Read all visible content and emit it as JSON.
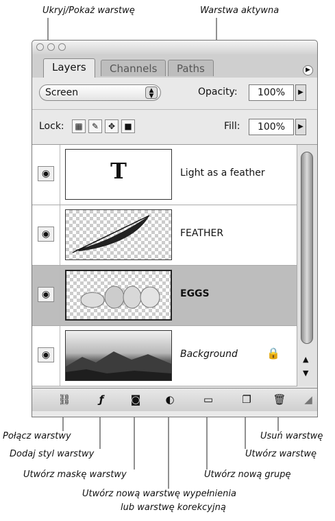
{
  "callouts": {
    "toggle_visibility": "Ukryj/Pokaż warstwę",
    "active_layer": "Warstwa aktywna",
    "link_layers": "Połącz warstwy",
    "add_layer_style": "Dodaj styl warstwy",
    "add_layer_mask": "Utwórz maskę warstwy",
    "new_fill_adjustment_line1": "Utwórz nową warstwę wypełnienia",
    "new_fill_adjustment_line2": "lub warstwę korekcyjną",
    "new_group": "Utwórz nową grupę",
    "new_layer": "Utwórz warstwę",
    "delete_layer": "Usuń warstwę"
  },
  "panel": {
    "tabs": [
      "Layers",
      "Channels",
      "Paths"
    ],
    "active_tab": "Layers",
    "blend_mode": "Screen",
    "opacity_label": "Opacity:",
    "opacity_value": "100%",
    "lock_label": "Lock:",
    "fill_label": "Fill:",
    "fill_value": "100%"
  },
  "layers": [
    {
      "name": "Light as a feather",
      "type": "text",
      "thumb_glyph": "T",
      "visible": true,
      "selected": false
    },
    {
      "name": "FEATHER",
      "type": "image",
      "visible": true,
      "selected": false
    },
    {
      "name": "EGGS",
      "type": "image",
      "visible": true,
      "selected": true
    },
    {
      "name": "Background",
      "type": "background",
      "visible": true,
      "selected": false,
      "locked": true
    }
  ],
  "icons": {
    "eye": "eye-icon",
    "link": "link-icon",
    "fx": "fx-icon",
    "mask": "mask-icon",
    "adjustment": "adjustment-icon",
    "folder": "folder-icon",
    "new_layer": "new-layer-icon",
    "trash": "trash-icon",
    "lock": "lock-icon"
  },
  "colors": {
    "selected_row": "#bdbdbd",
    "panel_bg": "#e9e9e9"
  }
}
